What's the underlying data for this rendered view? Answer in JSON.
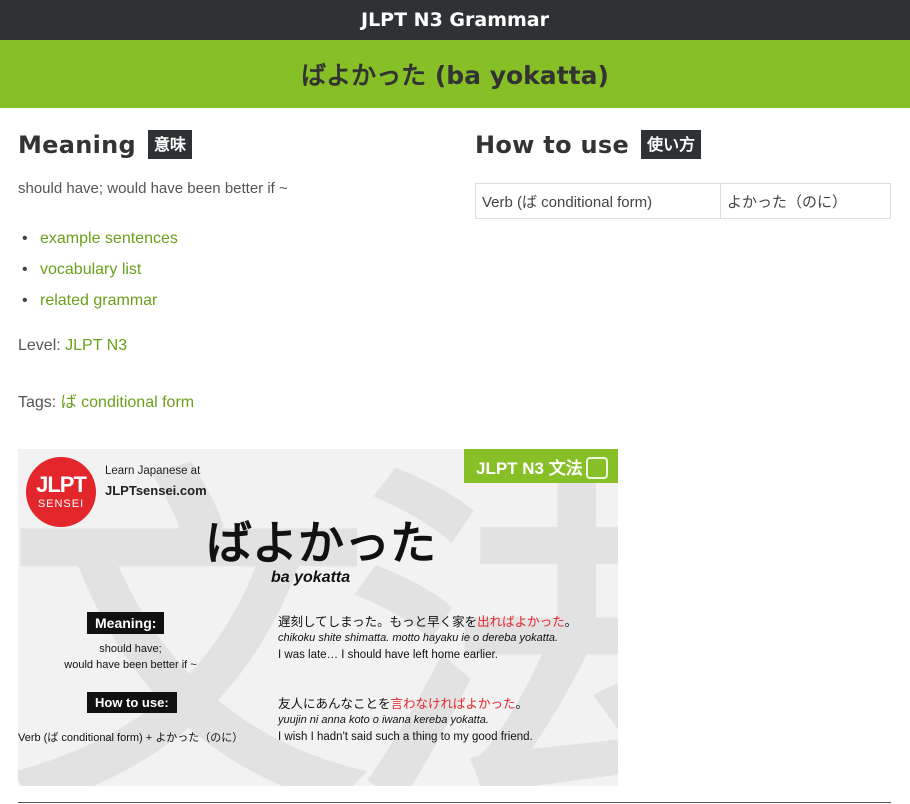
{
  "site": {
    "title": "JLPT N3 Grammar"
  },
  "page": {
    "title": "ばよかった (ba yokatta)"
  },
  "meaning": {
    "heading": "Meaning",
    "badge": "意味",
    "text": "should have; would have been better if ~"
  },
  "links": [
    {
      "label": "example sentences"
    },
    {
      "label": "vocabulary list"
    },
    {
      "label": "related grammar"
    }
  ],
  "level": {
    "label": "Level:",
    "value": "JLPT N3"
  },
  "tags": {
    "label": "Tags:",
    "value": "ば conditional form"
  },
  "how_to_use": {
    "heading": "How to use",
    "badge": "使い方",
    "table": [
      [
        "Verb (ば conditional form)",
        "よかった（のに）"
      ]
    ]
  },
  "card": {
    "logo_line1": "JLPT",
    "logo_line2": "SENSEI",
    "learn_text": "Learn Japanese at",
    "site_text": "JLPTsensei.com",
    "tag": "JLPT N3 文法",
    "bg_kanji_1": "文",
    "bg_kanji_2": "法",
    "grammar": "ばよかった",
    "romaji": "ba yokatta",
    "meaning_label": "Meaning:",
    "meaning_line1": "should have;",
    "meaning_line2": "would have been better if ~",
    "howto_label": "How to use:",
    "howto_text": "Verb (ば conditional form)  + よかった（のに）",
    "examples": [
      {
        "jp_before": "遅刻してしまった。もっと早く家を",
        "jp_highlight": "出ればよかった",
        "jp_after": "。",
        "romaji": "chikoku shite shimatta. motto hayaku ie o dereba yokatta.",
        "english": "I was late… I should have left home earlier."
      },
      {
        "jp_before": "友人にあんなことを",
        "jp_highlight": "言わなければよかった",
        "jp_after": "。",
        "romaji": "yuujin ni anna koto o iwana kereba yokatta.",
        "english": "I wish I hadn't said such a thing to my good friend."
      }
    ]
  }
}
